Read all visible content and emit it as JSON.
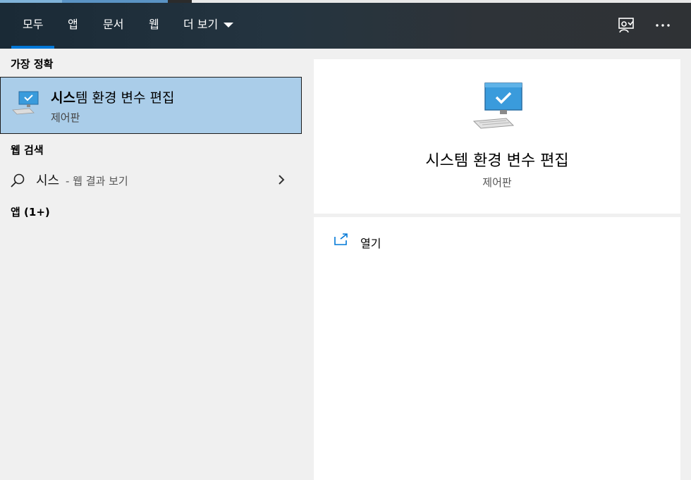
{
  "tabs": [
    {
      "label": "모두"
    },
    {
      "label": "앱"
    },
    {
      "label": "문서"
    },
    {
      "label": "웹"
    },
    {
      "label": "더 보기"
    }
  ],
  "left": {
    "best_match_heading": "가장 정확",
    "best_match": {
      "title_bold": "시스",
      "title_rest": "템 환경 변수 편집",
      "subtitle": "제어판"
    },
    "web_heading": "웹 검색",
    "web_result": {
      "query": "시스",
      "suffix": "- 웹 결과 보기"
    },
    "apps_heading": "앱 (1+)"
  },
  "preview": {
    "title": "시스템 환경 변수 편집",
    "subtitle": "제어판",
    "actions": [
      {
        "label": "열기",
        "icon": "open-external-icon"
      }
    ]
  },
  "colors": {
    "accent": "#0078d7",
    "selected_bg": "#aacde9"
  }
}
